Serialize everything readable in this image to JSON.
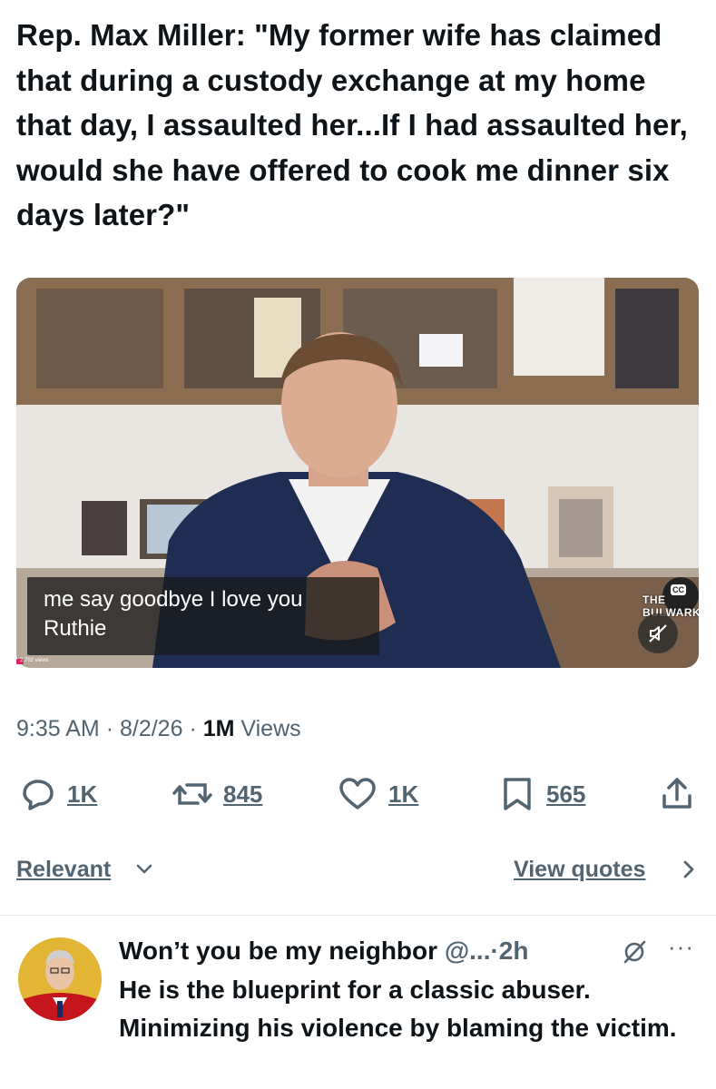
{
  "post": {
    "text": "Rep. Max Miller: \"My former wife has claimed that during a custody exchange at my home that day, I assaulted her...If I had assaulted her, would she have offered to cook me dinner six days later?\""
  },
  "video": {
    "caption_line1": "me say goodbye I love you",
    "caption_line2": "Ruthie",
    "cc_label": "CC",
    "watermark": "THE BULWARK",
    "tiny_views": "2,702 views",
    "mute_icon": "speaker-muted-icon"
  },
  "meta": {
    "time": "9:35 AM",
    "sep": "·",
    "date": "8/2/26",
    "views_count": "1M",
    "views_label": "Views"
  },
  "actions": {
    "replies": "1K",
    "reposts": "845",
    "likes": "1K",
    "bookmarks": "565"
  },
  "sort": {
    "relevant_label": "Relevant",
    "view_quotes_label": "View quotes"
  },
  "reply": {
    "name": "Won’t you be my neighbor",
    "handle": "@...",
    "time": "2h",
    "text": "He is the blueprint for a classic abuser. Minimizing his violence by blaming the victim."
  },
  "colors": {
    "text": "#0f1419",
    "secondary": "#536471",
    "divider": "#e6e9ec"
  }
}
